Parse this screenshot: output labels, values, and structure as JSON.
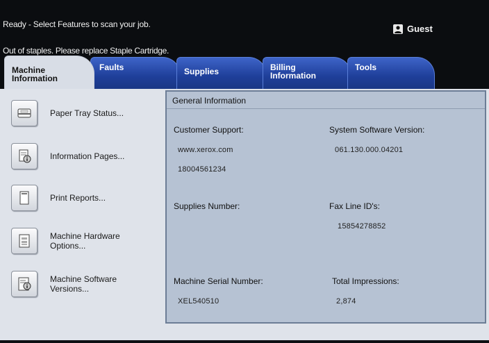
{
  "status": {
    "line1": "Ready -  Select Features to scan your job.",
    "line2": "Out of staples. Please replace Staple Cartridge.",
    "user": "Guest"
  },
  "tabs": [
    {
      "line1": "Machine",
      "line2": "Information"
    },
    {
      "line1": "Faults",
      "line2": ""
    },
    {
      "line1": "Supplies",
      "line2": ""
    },
    {
      "line1": "Billing",
      "line2": "Information"
    },
    {
      "line1": "Tools",
      "line2": ""
    }
  ],
  "sidebar": [
    {
      "line1": "Paper Tray Status...",
      "line2": "",
      "icon": "paper-tray-icon"
    },
    {
      "line1": "Information Pages...",
      "line2": "",
      "icon": "information-pages-icon"
    },
    {
      "line1": "Print Reports...",
      "line2": "",
      "icon": "print-reports-icon"
    },
    {
      "line1": "Machine Hardware",
      "line2": "Options...",
      "icon": "hardware-options-icon"
    },
    {
      "line1": "Machine Software",
      "line2": "Versions...",
      "icon": "software-versions-icon"
    }
  ],
  "info": {
    "title": "General Information",
    "customer_support_label": "Customer Support:",
    "customer_support_url": "www.xerox.com",
    "customer_support_phone": "18004561234",
    "software_version_label": "System Software Version:",
    "software_version": "061.130.000.04201",
    "supplies_number_label": "Supplies Number:",
    "fax_line_label": "Fax Line ID's:",
    "fax_line": "15854278852",
    "serial_label": "Machine Serial Number:",
    "serial": "XEL540510",
    "impressions_label": "Total Impressions:",
    "impressions": "2,874"
  }
}
